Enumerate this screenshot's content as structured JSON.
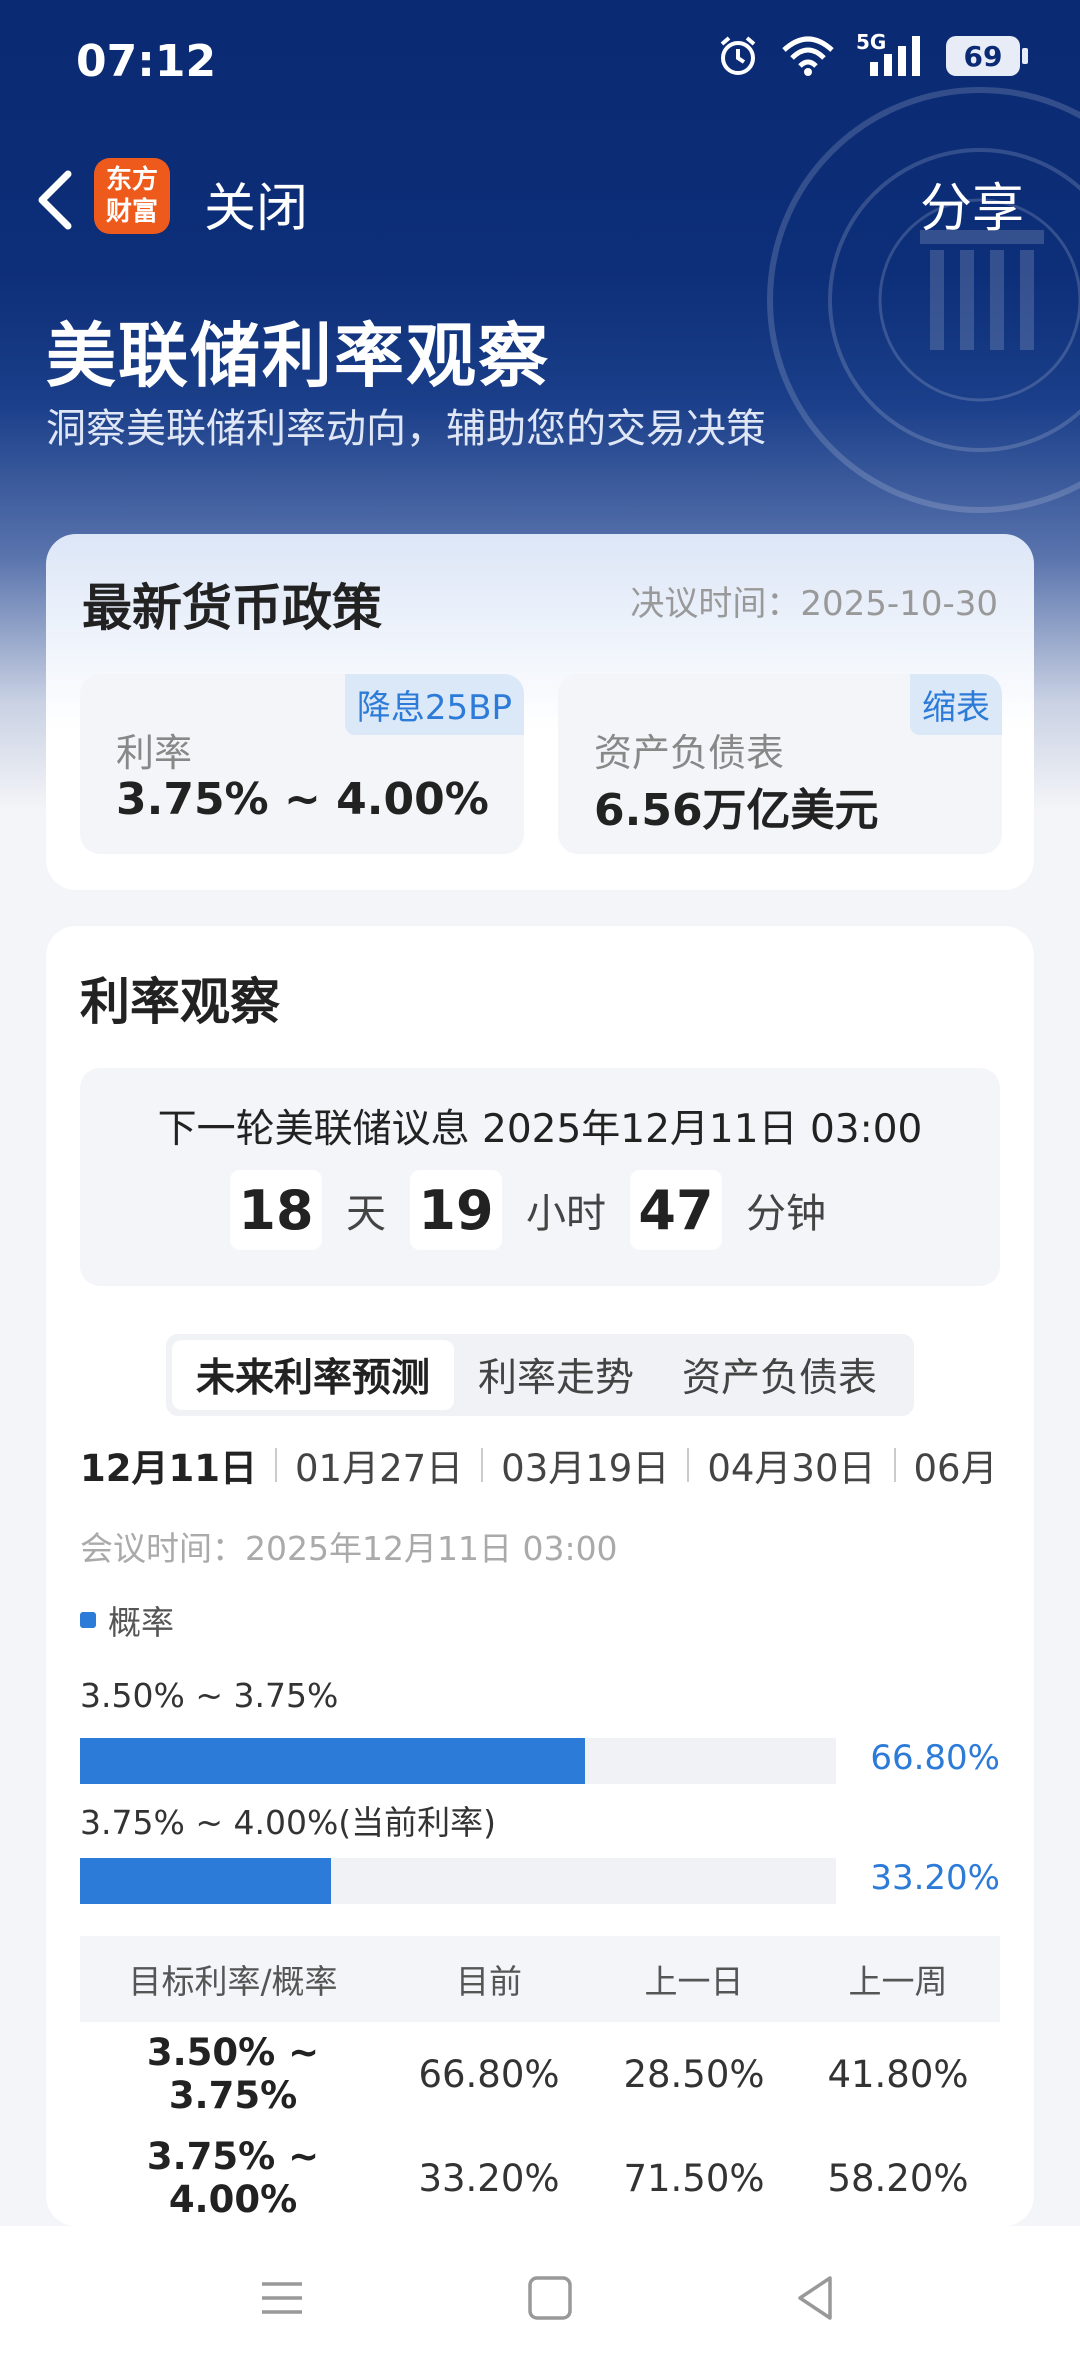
{
  "status_bar": {
    "time": "07:12",
    "network": "5G",
    "battery": "69",
    "icons": [
      "alarm-icon",
      "wifi-icon",
      "signal-icon",
      "battery-icon"
    ]
  },
  "nav": {
    "logo_line1": "东方",
    "logo_line2": "财富",
    "close_label": "关闭",
    "share_label": "分享"
  },
  "hero": {
    "title": "美联储利率观察",
    "subtitle": "洞察美联储利率动向，辅助您的交易决策"
  },
  "policy": {
    "title": "最新货币政策",
    "decision_time": "决议时间：2025-10-30",
    "rate": {
      "tag": "降息25BP",
      "label": "利率",
      "value": "3.75% ~ 4.00%"
    },
    "balance_sheet": {
      "tag": "缩表",
      "label": "资产负债表",
      "value": "6.56万亿美元"
    }
  },
  "watch": {
    "title": "利率观察",
    "next_meeting": "下一轮美联储议息 2025年12月11日 03:00",
    "countdown": {
      "days": "18",
      "days_unit": "天",
      "hours": "19",
      "hours_unit": "小时",
      "minutes": "47",
      "minutes_unit": "分钟"
    },
    "tabs": [
      "未来利率预测",
      "利率走势",
      "资产负债表"
    ],
    "active_tab": 0,
    "dates": [
      "12月11日",
      "01月27日",
      "03月19日",
      "04月30日",
      "06月"
    ],
    "meeting_time": "会议时间：2025年12月11日 03:00",
    "legend": "概率",
    "accent_color": "#2d7bd8",
    "bars": [
      {
        "label": "3.50% ~ 3.75%",
        "pct_text": "66.80%",
        "value": 66.8
      },
      {
        "label": "3.75% ~ 4.00%(当前利率)",
        "pct_text": "33.20%",
        "value": 33.2
      }
    ],
    "table": {
      "headers": [
        "目标利率/概率",
        "目前",
        "上一日",
        "上一周"
      ],
      "rows": [
        [
          "3.50% ~ 3.75%",
          "66.80%",
          "28.50%",
          "41.80%"
        ],
        [
          "3.75% ~ 4.00%",
          "33.20%",
          "71.50%",
          "58.20%"
        ]
      ]
    }
  }
}
